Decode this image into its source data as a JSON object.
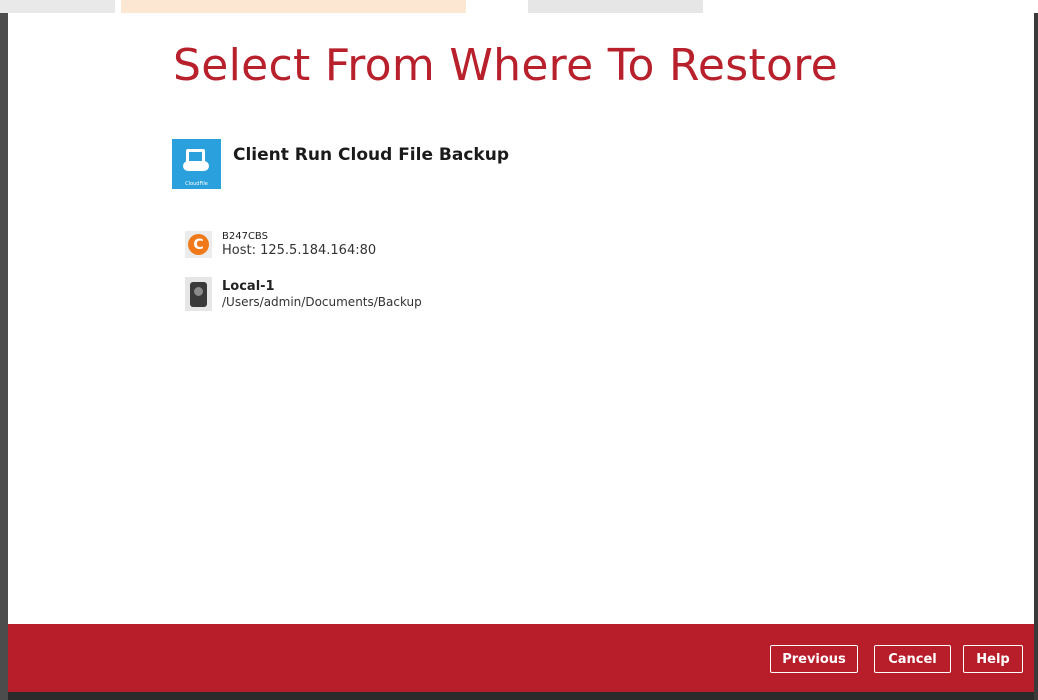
{
  "page": {
    "title": "Select From Where To Restore"
  },
  "backup_set": {
    "name": "Client Run Cloud File Backup",
    "icon": "cloud-file-icon",
    "icon_caption": "CloudFile"
  },
  "destinations": [
    {
      "name": "B247CBS",
      "detail": "Host: 125.5.184.164:80",
      "icon": "cbs-server-icon",
      "icon_glyph": "C"
    },
    {
      "name": "Local-1",
      "detail": "/Users/admin/Documents/Backup",
      "icon": "local-disk-icon"
    }
  ],
  "footer": {
    "previous_label": "Previous",
    "cancel_label": "Cancel",
    "help_label": "Help"
  },
  "colors": {
    "accent": "#b81e2a",
    "title_red": "#b8202c",
    "cloud_icon_blue": "#2aa0dc",
    "cbs_orange": "#f07a1a"
  }
}
